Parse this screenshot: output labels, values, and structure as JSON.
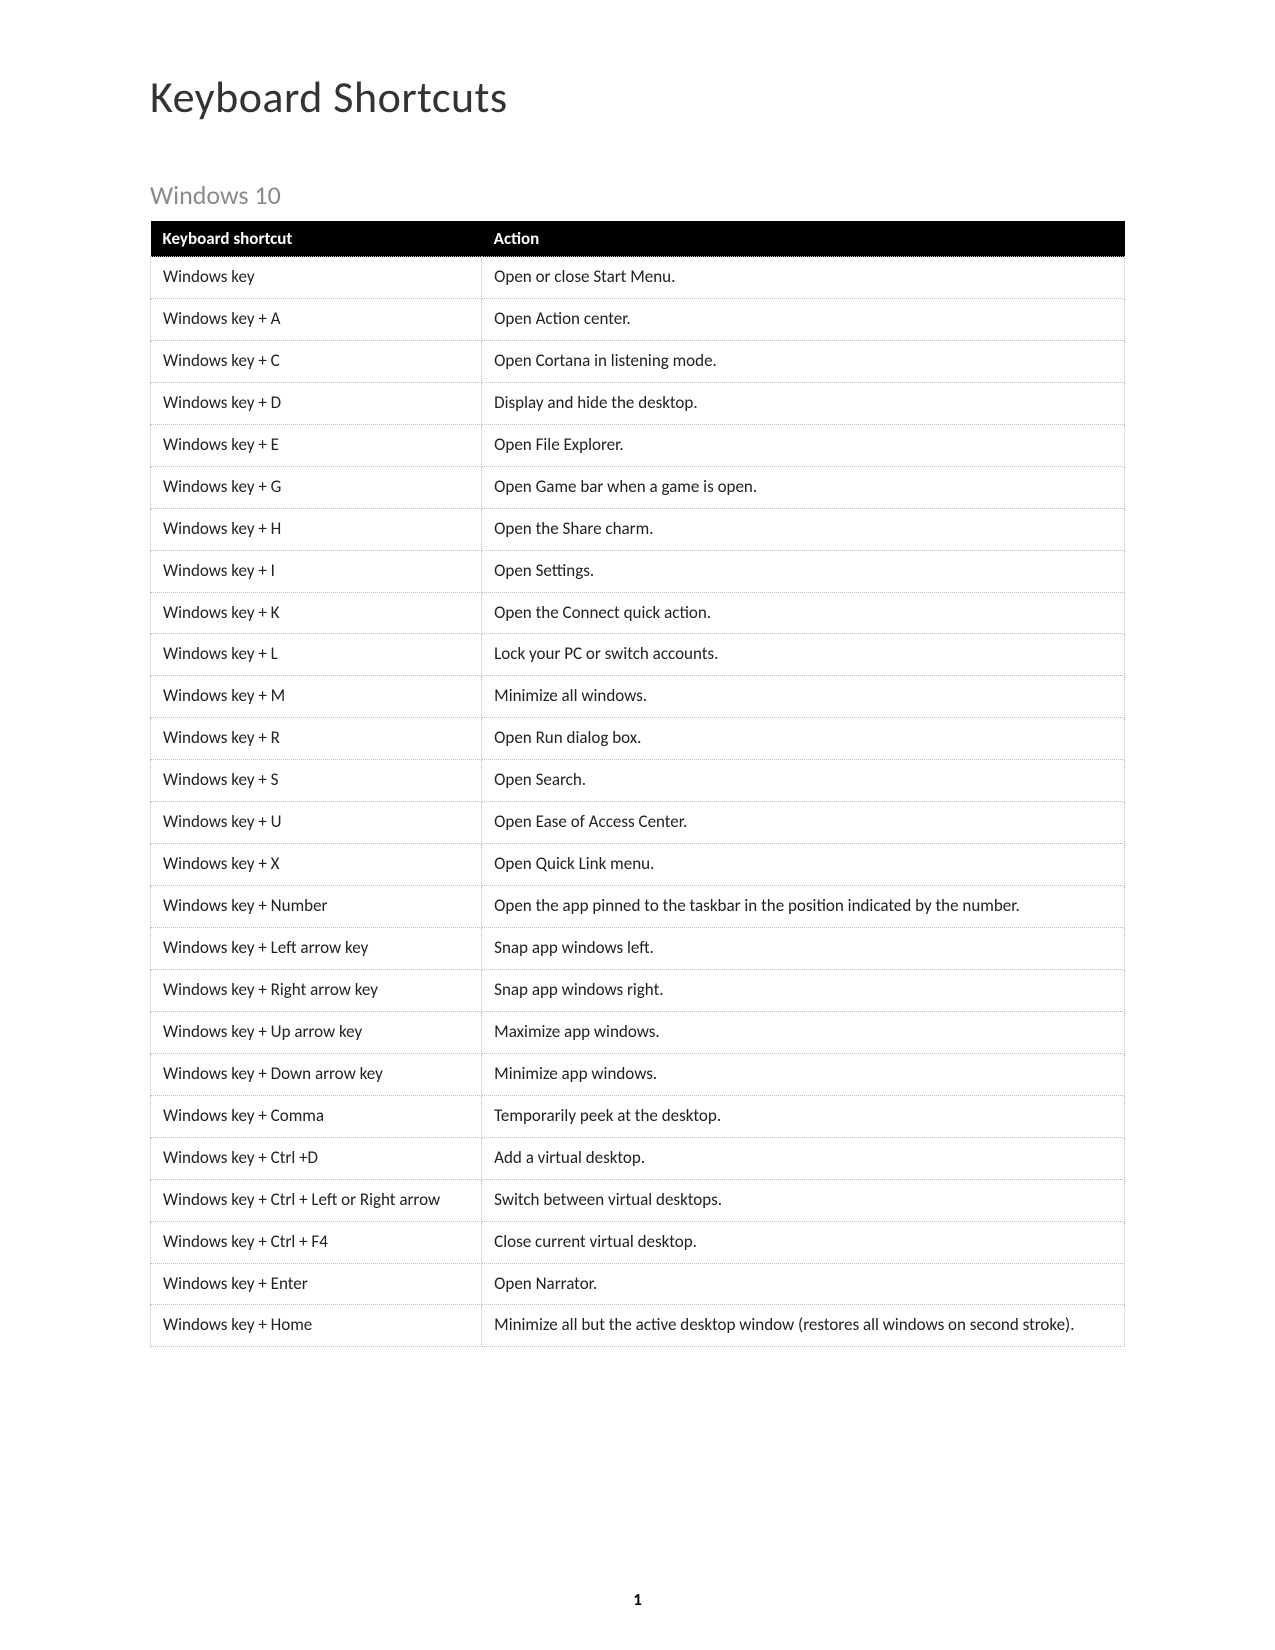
{
  "title": "Keyboard Shortcuts",
  "section": "Windows 10",
  "headers": {
    "shortcut": "Keyboard shortcut",
    "action": "Action"
  },
  "rows": [
    {
      "shortcut": "Windows key",
      "action": "Open or close Start Menu."
    },
    {
      "shortcut": "Windows key + A",
      "action": "Open Action center."
    },
    {
      "shortcut": "Windows key + C",
      "action": "Open Cortana in listening mode."
    },
    {
      "shortcut": "Windows key + D",
      "action": "Display and hide the desktop."
    },
    {
      "shortcut": "Windows key + E",
      "action": "Open File Explorer."
    },
    {
      "shortcut": "Windows key + G",
      "action": "Open Game bar when a game is open."
    },
    {
      "shortcut": "Windows key + H",
      "action": "Open the Share charm."
    },
    {
      "shortcut": "Windows key + I",
      "action": "Open Settings."
    },
    {
      "shortcut": "Windows key + K",
      "action": "Open the Connect quick action."
    },
    {
      "shortcut": "Windows key + L",
      "action": "Lock your PC or switch accounts."
    },
    {
      "shortcut": "Windows key + M",
      "action": "Minimize all windows."
    },
    {
      "shortcut": "Windows key + R",
      "action": "Open Run dialog box."
    },
    {
      "shortcut": "Windows key + S",
      "action": "Open Search."
    },
    {
      "shortcut": "Windows key + U",
      "action": "Open Ease of Access Center."
    },
    {
      "shortcut": "Windows key + X",
      "action": "Open Quick Link menu."
    },
    {
      "shortcut": "Windows key + Number",
      "action": "Open the app pinned to the taskbar in the position indicated by the number."
    },
    {
      "shortcut": "Windows key + Left arrow key",
      "action": "Snap app windows left."
    },
    {
      "shortcut": "Windows key + Right arrow key",
      "action": "Snap app windows right."
    },
    {
      "shortcut": "Windows key + Up arrow key",
      "action": "Maximize app windows."
    },
    {
      "shortcut": "Windows key + Down arrow key",
      "action": "Minimize app windows."
    },
    {
      "shortcut": "Windows key + Comma",
      "action": "Temporarily peek at the desktop."
    },
    {
      "shortcut": "Windows key + Ctrl +D",
      "action": "Add a virtual desktop."
    },
    {
      "shortcut": "Windows key + Ctrl + Left or Right arrow",
      "action": "Switch between virtual desktops."
    },
    {
      "shortcut": "Windows key + Ctrl + F4",
      "action": "Close current virtual desktop."
    },
    {
      "shortcut": "Windows key + Enter",
      "action": "Open Narrator."
    },
    {
      "shortcut": "Windows key + Home",
      "action": "Minimize all but the active desktop window (restores all windows on second stroke)."
    }
  ],
  "pageNumber": "1"
}
